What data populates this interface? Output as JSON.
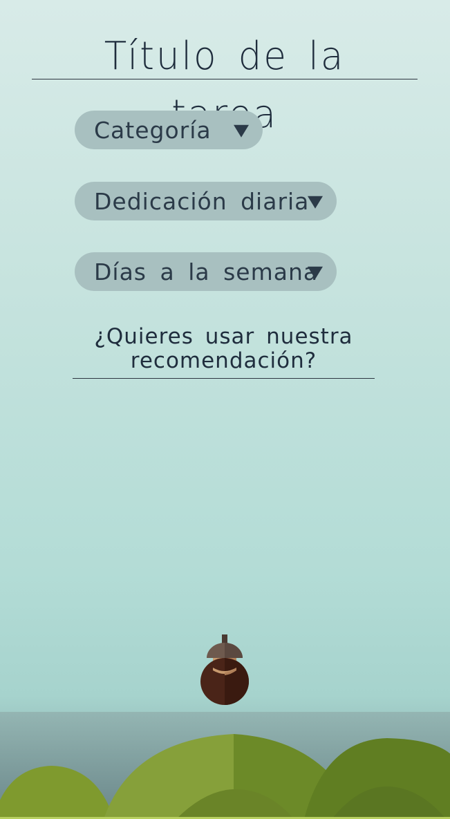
{
  "task": {
    "title": "Título de la tarea"
  },
  "dropdowns": {
    "category": {
      "label": "Categoría"
    },
    "daily_dedication": {
      "label": "Dedicación diaria"
    },
    "days_per_week": {
      "label": "Días a la semana"
    }
  },
  "recommendation": {
    "line1": "¿Quieres usar nuestra",
    "line2": "recomendación?"
  },
  "colors": {
    "text": "#1f2d3d",
    "pill": "#a8c0c0",
    "hill_light": "#7f9a32",
    "hill_dark": "#5c7420"
  },
  "icons": {
    "dropdown": "triangle-down-icon",
    "mascot": "acorn-icon"
  }
}
